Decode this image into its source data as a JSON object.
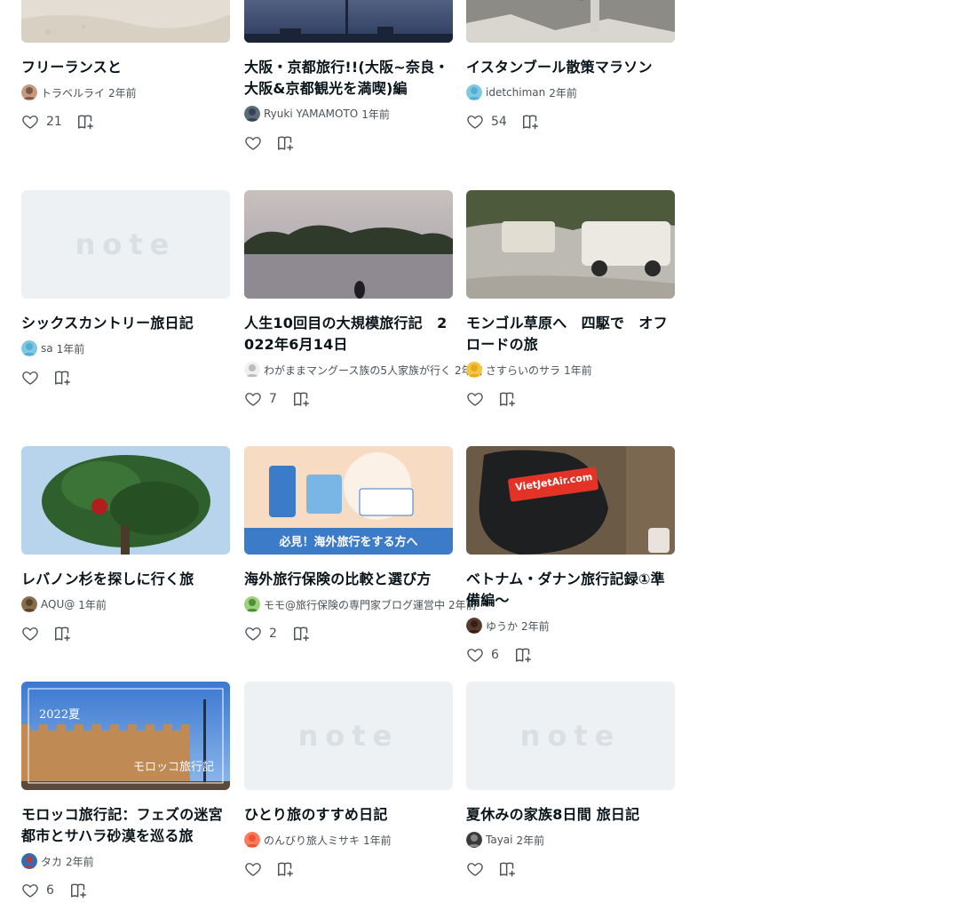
{
  "cards": [
    {
      "title": "フリーランスと",
      "author": "トラベルライ",
      "time": "2年前",
      "likes": "21",
      "thumb": "sand"
    },
    {
      "title": "大阪・京都旅行!!(大阪~奈良・大阪&京都観光を満喫)編",
      "author": "Ryuki YAMAMOTO",
      "time": "1年前",
      "likes": "",
      "thumb": "skytree"
    },
    {
      "title": "イスタンブール散策マラソン",
      "author": "idetchiman",
      "time": "2年前",
      "likes": "54",
      "thumb": "rock"
    },
    {
      "title": "シックスカントリー旅日記",
      "author": "sa",
      "time": "1年前",
      "likes": "",
      "thumb": "note"
    },
    {
      "title": "人生10回目の大規模旅行記　2022年6月14日",
      "author": "わがままマングース族の5人家族が行く",
      "time": "2年前",
      "likes": "7",
      "thumb": "lake"
    },
    {
      "title": "モンゴル草原へ　四駆で　オフロードの旅",
      "author": "さすらいのサラ",
      "time": "1年前",
      "likes": "",
      "thumb": "jeep"
    },
    {
      "title": "レバノン杉を探しに行く旅",
      "author": "AQU@",
      "time": "1年前",
      "likes": "",
      "thumb": "tree"
    },
    {
      "title": "海外旅行保険の比較と選び方",
      "author": "モモ@旅行保険の専門家ブログ運営中",
      "time": "2年前",
      "likes": "2",
      "thumb": "illust"
    },
    {
      "title": "ベトナム・ダナン旅行記録①準備編～",
      "author": "ゆうか",
      "time": "2年前",
      "likes": "6",
      "thumb": "bag"
    },
    {
      "title": "モロッコ旅行記：フェズの迷宮都市とサハラ砂漠を巡る旅",
      "author": "タカ",
      "time": "2年前",
      "likes": "6",
      "thumb": "morocco"
    },
    {
      "title": "ひとり旅のすすめ日記",
      "author": "のんびり旅人ミサキ",
      "time": "1年前",
      "likes": "",
      "thumb": "note"
    },
    {
      "title": "夏休みの家族8日間 旅日記",
      "author": "Tayai",
      "time": "2年前",
      "likes": "",
      "thumb": "note"
    }
  ],
  "thumb_texts": {
    "illust_caption": "必見！海外旅行をする方へ",
    "bag_brand": "VietJetAir.com",
    "morocco_year": "2022夏",
    "morocco_caption": "モロッコ旅行記",
    "note_logo": "note"
  },
  "colors": {
    "accent": "#2cb696",
    "text": "#08131a",
    "sub": "#4a5256",
    "placeholder": "#eef1f3"
  }
}
